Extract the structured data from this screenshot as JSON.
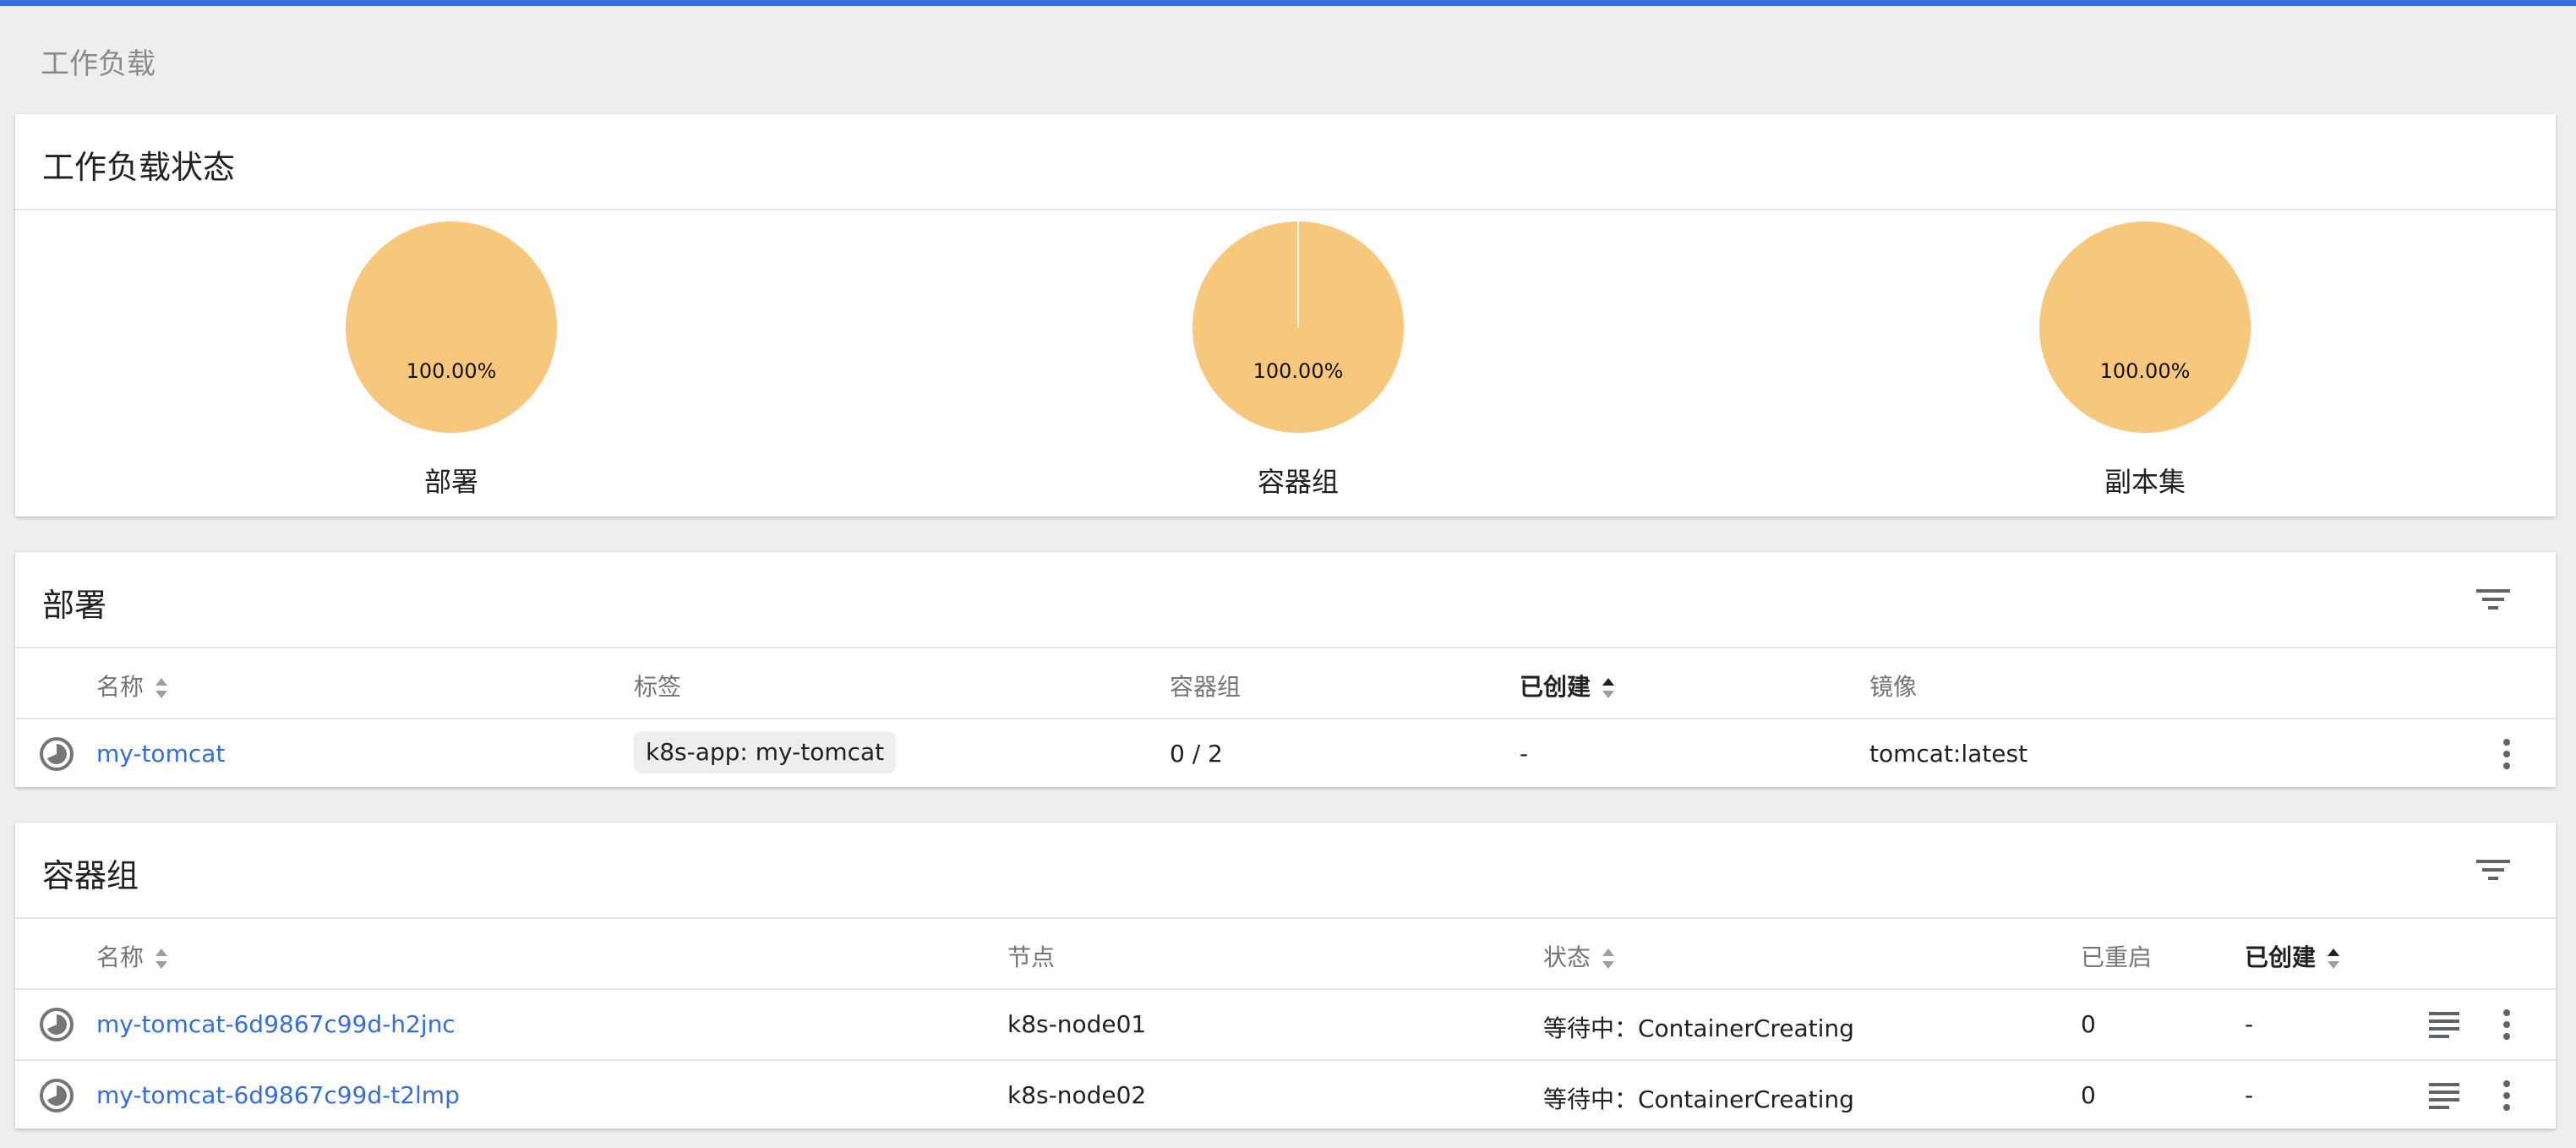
{
  "breadcrumb": "工作负载",
  "status_card": {
    "title": "工作负载状态",
    "charts": [
      {
        "label": "部署",
        "percent_text": "100.00%",
        "color": "#f7c77b"
      },
      {
        "label": "容器组",
        "percent_text": "100.00%",
        "color": "#f7c77b"
      },
      {
        "label": "副本集",
        "percent_text": "100.00%",
        "color": "#f7c77b"
      }
    ]
  },
  "deployments": {
    "title": "部署",
    "columns": {
      "name": "名称",
      "labels": "标签",
      "pods": "容器组",
      "created": "已创建",
      "images": "镜像"
    },
    "rows": [
      {
        "name": "my-tomcat",
        "label": "k8s-app: my-tomcat",
        "pods": "0 / 2",
        "created": "-",
        "image": "tomcat:latest"
      }
    ]
  },
  "pods": {
    "title": "容器组",
    "columns": {
      "name": "名称",
      "node": "节点",
      "status": "状态",
      "restarts": "已重启",
      "created": "已创建"
    },
    "rows": [
      {
        "name": "my-tomcat-6d9867c99d-h2jnc",
        "node": "k8s-node01",
        "status": "等待中：ContainerCreating",
        "restarts": "0",
        "created": "-"
      },
      {
        "name": "my-tomcat-6d9867c99d-t2lmp",
        "node": "k8s-node02",
        "status": "等待中：ContainerCreating",
        "restarts": "0",
        "created": "-"
      }
    ]
  },
  "icons": {
    "filter": "filter-icon",
    "sort": "sort-icon",
    "status": "pending-status-icon",
    "more": "more-vert-icon",
    "logs": "logs-icon"
  },
  "colors": {
    "accent": "#326de6",
    "pie": "#f7c77b"
  }
}
